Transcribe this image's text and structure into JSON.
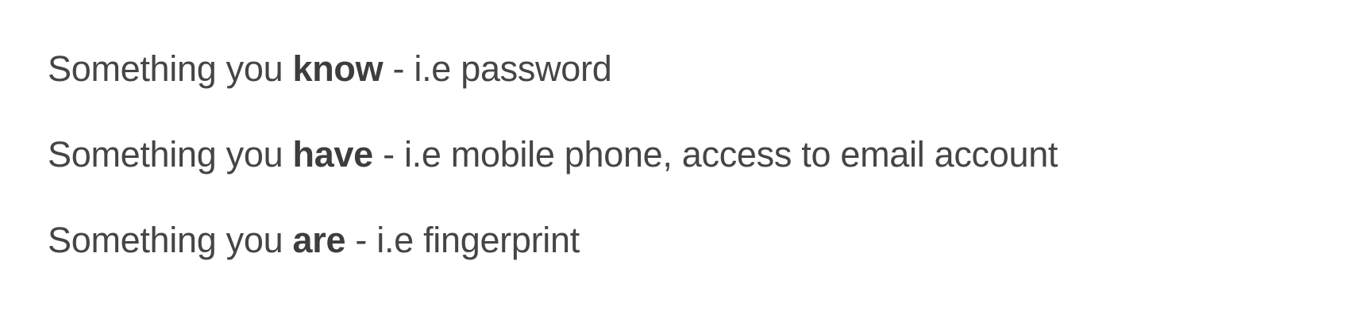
{
  "factors": [
    {
      "prefix": "Something you ",
      "keyword": "know",
      "suffix": " - i.e password"
    },
    {
      "prefix": "Something you ",
      "keyword": "have",
      "suffix": " - i.e mobile phone, access to email account"
    },
    {
      "prefix": "Something you ",
      "keyword": "are",
      "suffix": " - i.e fingerprint"
    }
  ],
  "colors": {
    "text": "#454545",
    "background": "#ffffff"
  }
}
